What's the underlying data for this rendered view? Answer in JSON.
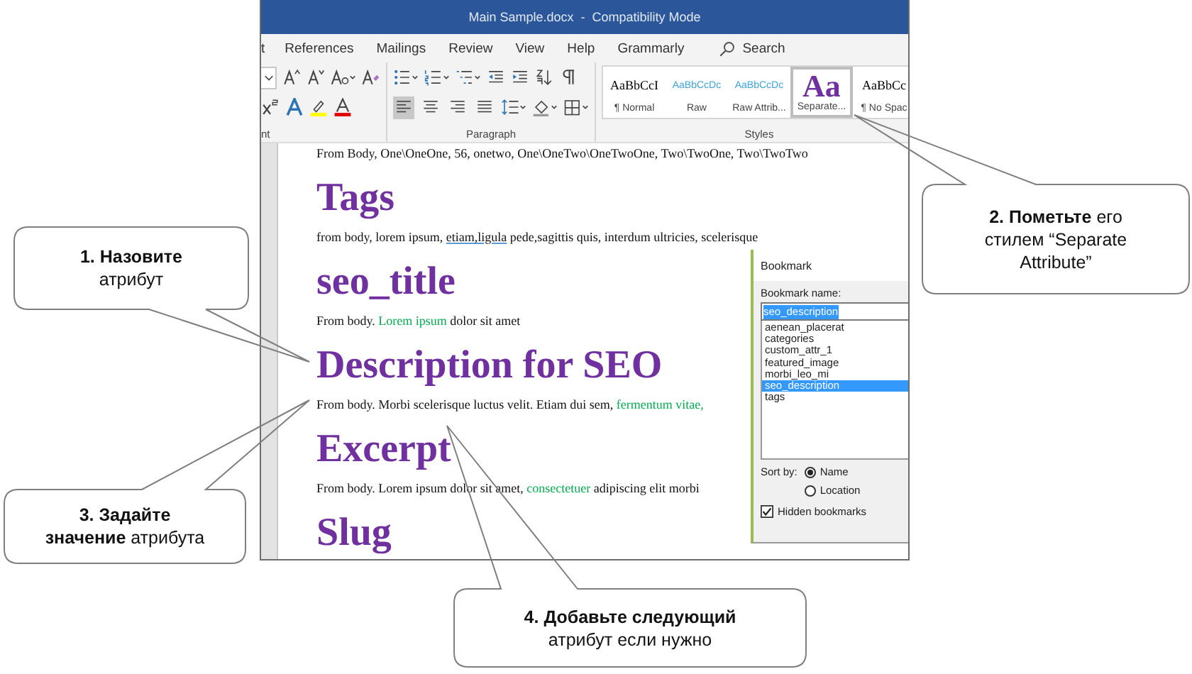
{
  "window": {
    "title": "Main Sample.docx  -  Compatibility Mode"
  },
  "ribbon_tabs": [
    {
      "label": "t"
    },
    {
      "label": "References"
    },
    {
      "label": "Mailings"
    },
    {
      "label": "Review"
    },
    {
      "label": "View"
    },
    {
      "label": "Help"
    },
    {
      "label": "Grammarly"
    }
  ],
  "search": {
    "placeholder": "Search"
  },
  "ribbon_groups": [
    {
      "label": "nt"
    },
    {
      "label": "Paragraph"
    },
    {
      "label": "Styles"
    }
  ],
  "alignment_buttons": [
    {
      "selected": true
    },
    {
      "selected": false
    },
    {
      "selected": false
    },
    {
      "selected": false
    }
  ],
  "styles": [
    {
      "kind": "normal",
      "sample": "AaBbCcI",
      "name": "¶ Normal",
      "selected": false
    },
    {
      "kind": "raw",
      "sample": "AaBbCcDc",
      "name": "Raw",
      "selected": false
    },
    {
      "kind": "raw",
      "sample": "AaBbCcDc",
      "name": "Raw Attrib...",
      "selected": false
    },
    {
      "kind": "title",
      "sample": "Aa",
      "name": "Separate...",
      "selected": true
    },
    {
      "kind": "normal",
      "sample": "AaBbCc",
      "name": "¶ No Spac",
      "selected": false
    }
  ],
  "document": {
    "blocks": [
      {
        "kind": "body",
        "parts": [
          {
            "kind": "plain",
            "text": "From Body, One\\OneOne, 56, onetwo, One\\OneTwo\\OneTwoOne, Two\\TwoOne, Two\\TwoTwo"
          }
        ]
      },
      {
        "kind": "heading",
        "text": "Tags"
      },
      {
        "kind": "body",
        "parts": [
          {
            "kind": "plain",
            "text": "from body, lorem ipsum, "
          },
          {
            "kind": "marked",
            "text": "etiam,ligula"
          },
          {
            "kind": "plain",
            "text": " pede,sagittis quis, interdum ultricies, scelerisque"
          }
        ]
      },
      {
        "kind": "heading",
        "text": "seo_title"
      },
      {
        "kind": "body",
        "parts": [
          {
            "kind": "plain",
            "text": "From body. "
          },
          {
            "kind": "green",
            "text": "Lorem ipsum"
          },
          {
            "kind": "plain",
            "text": " dolor sit amet"
          }
        ]
      },
      {
        "kind": "heading",
        "text": "Description for SEO"
      },
      {
        "kind": "body",
        "parts": [
          {
            "kind": "plain",
            "text": "From body. Morbi scelerisque luctus velit. Etiam dui sem, "
          },
          {
            "kind": "green",
            "text": "fermentum vitae,"
          }
        ]
      },
      {
        "kind": "heading",
        "text": "Excerpt"
      },
      {
        "kind": "body",
        "parts": [
          {
            "kind": "plain",
            "text": "From body. Lorem ipsum dolor sit amet, "
          },
          {
            "kind": "green",
            "text": "consectetuer"
          },
          {
            "kind": "plain",
            "text": " adipiscing elit morbi"
          }
        ]
      },
      {
        "kind": "heading",
        "text": "Slug"
      }
    ]
  },
  "dialog": {
    "title": "Bookmark",
    "name_label": "Bookmark name:",
    "name_value": "seo_description",
    "items": [
      {
        "label": "aenean_placerat",
        "selected": false
      },
      {
        "label": "categories",
        "selected": false
      },
      {
        "label": "custom_attr_1",
        "selected": false
      },
      {
        "label": "featured_image",
        "selected": false
      },
      {
        "label": "morbi_leo_mi",
        "selected": false
      },
      {
        "label": "seo_description",
        "selected": true
      },
      {
        "label": "tags",
        "selected": false
      }
    ],
    "sort_label": "Sort by:",
    "sort_options": [
      {
        "label": "Name",
        "selected": true
      },
      {
        "label": "Location",
        "selected": false
      }
    ],
    "hidden_bookmarks": {
      "label": "Hidden bookmarks",
      "checked": true
    }
  },
  "callouts": [
    {
      "text": "**1. Назовите**\nатрибут"
    },
    {
      "text": "**2. Пометьте** его\nстилем “Separate\nAttribute”"
    },
    {
      "text": "**3. Задайте**\n**значение** атрибута"
    },
    {
      "text": "**4. Добавьте следующий**\nатрибут если нужно"
    }
  ]
}
